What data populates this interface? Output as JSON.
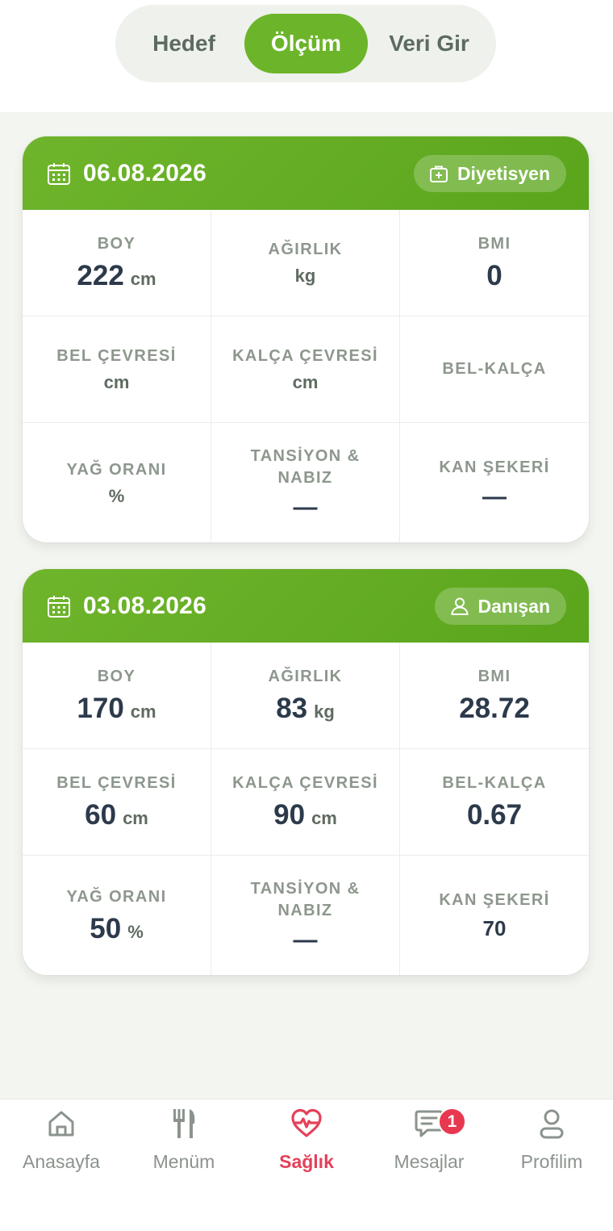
{
  "segments": {
    "goal": "Hedef",
    "measurement": "Ölçüm",
    "enter_data": "Veri Gir",
    "active": "Ölçüm"
  },
  "colors": {
    "accent_green": "#6cb52a",
    "active_tab": "#e5405a",
    "badge": "#e8384f",
    "text_dark": "#2c3a4b"
  },
  "cards": [
    {
      "date": "06.08.2026",
      "source": "Diyetisyen",
      "source_icon": "medical-bag-icon",
      "height": {
        "label": "BOY",
        "value": "222",
        "unit": "cm"
      },
      "weight": {
        "label": "AĞIRLIK",
        "value": "",
        "unit": "kg"
      },
      "bmi": {
        "label": "BMI",
        "value": "0"
      },
      "waist": {
        "label": "BEL ÇEVRESİ",
        "value": "",
        "unit": "cm"
      },
      "hip": {
        "label": "KALÇA ÇEVRESİ",
        "value": "",
        "unit": "cm"
      },
      "waist_hip": {
        "label": "BEL-KALÇA",
        "value": ""
      },
      "fat": {
        "label": "YAĞ ORANI",
        "value": "",
        "unit": "%"
      },
      "bp": {
        "label": "TANSİYON & NABIZ",
        "value": "—"
      },
      "sugar": {
        "label": "KAN ŞEKERİ",
        "value": "—"
      }
    },
    {
      "date": "03.08.2026",
      "source": "Danışan",
      "source_icon": "user-icon",
      "height": {
        "label": "BOY",
        "value": "170",
        "unit": "cm"
      },
      "weight": {
        "label": "AĞIRLIK",
        "value": "83",
        "unit": "kg"
      },
      "bmi": {
        "label": "BMI",
        "value": "28.72"
      },
      "waist": {
        "label": "BEL ÇEVRESİ",
        "value": "60",
        "unit": "cm"
      },
      "hip": {
        "label": "KALÇA ÇEVRESİ",
        "value": "90",
        "unit": "cm"
      },
      "waist_hip": {
        "label": "BEL-KALÇA",
        "value": "0.67"
      },
      "fat": {
        "label": "YAĞ ORANI",
        "value": "50",
        "unit": "%"
      },
      "bp": {
        "label": "TANSİYON & NABIZ",
        "value": "—"
      },
      "sugar": {
        "label": "KAN ŞEKERİ",
        "value": "70"
      }
    }
  ],
  "tabbar": {
    "home": "Anasayfa",
    "menu": "Menüm",
    "health": "Sağlık",
    "messages": "Mesajlar",
    "profile": "Profilim",
    "messages_badge": "1",
    "active": "Sağlık"
  }
}
